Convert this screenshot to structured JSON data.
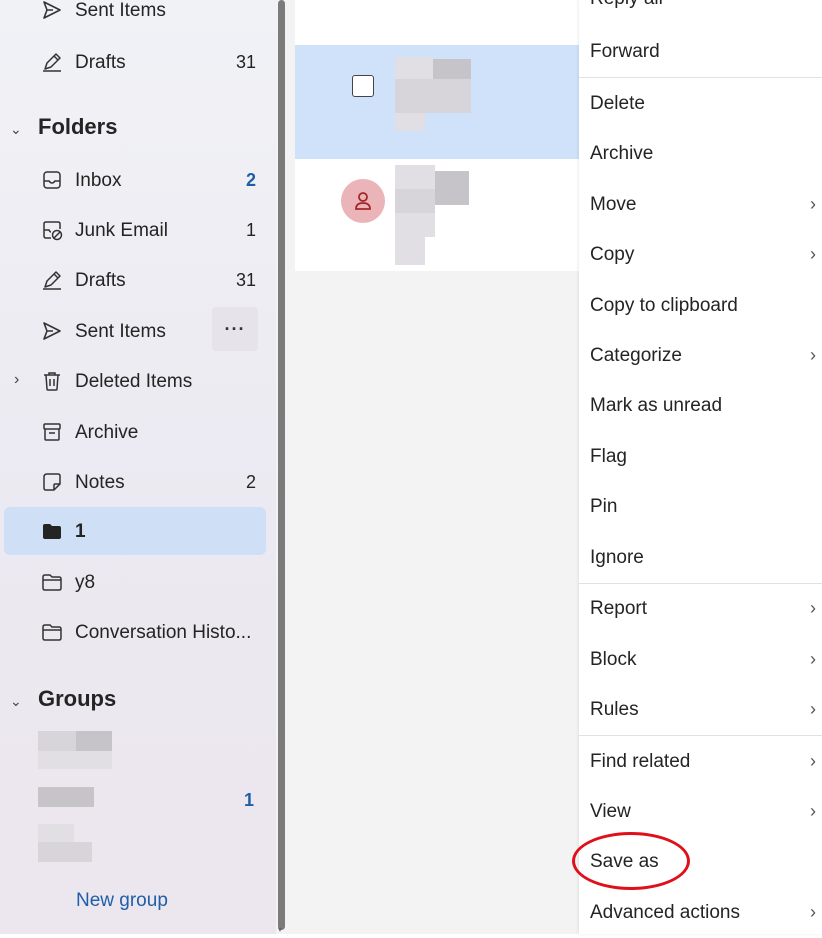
{
  "sidebar": {
    "top_items": [
      {
        "label": "Sent Items",
        "count": ""
      },
      {
        "label": "Drafts",
        "count": "31"
      }
    ],
    "folders_header": "Folders",
    "folders": [
      {
        "label": "Inbox",
        "count": "2",
        "icon": "inbox-icon"
      },
      {
        "label": "Junk Email",
        "count": "1",
        "icon": "junk-email-icon"
      },
      {
        "label": "Drafts",
        "count": "31",
        "icon": "drafts-icon"
      },
      {
        "label": "Sent Items",
        "count": "",
        "icon": "sent-icon"
      },
      {
        "label": "Deleted Items",
        "count": "",
        "icon": "trash-icon"
      },
      {
        "label": "Archive",
        "count": "",
        "icon": "archive-icon"
      },
      {
        "label": "Notes",
        "count": "2",
        "icon": "notes-icon"
      },
      {
        "label": "1",
        "count": "",
        "icon": "folder-filled-icon"
      },
      {
        "label": "y8",
        "count": "",
        "icon": "folder-icon"
      },
      {
        "label": "Conversation Histo...",
        "count": "",
        "icon": "folder-icon"
      }
    ],
    "more_label": "···",
    "groups_header": "Groups",
    "group_count": "1",
    "new_group_label": "New group"
  },
  "context_menu": {
    "partial_top_label": "Reply all",
    "items": [
      {
        "label": "Forward",
        "submenu": false
      },
      {
        "label": "Delete",
        "submenu": false
      },
      {
        "label": "Archive",
        "submenu": false
      },
      {
        "label": "Move",
        "submenu": true
      },
      {
        "label": "Copy",
        "submenu": true
      },
      {
        "label": "Copy to clipboard",
        "submenu": false
      },
      {
        "label": "Categorize",
        "submenu": true
      },
      {
        "label": "Mark as unread",
        "submenu": false
      },
      {
        "label": "Flag",
        "submenu": false
      },
      {
        "label": "Pin",
        "submenu": false
      },
      {
        "label": "Ignore",
        "submenu": false
      },
      {
        "label": "Report",
        "submenu": true
      },
      {
        "label": "Block",
        "submenu": true
      },
      {
        "label": "Rules",
        "submenu": true
      },
      {
        "label": "Find related",
        "submenu": true
      },
      {
        "label": "View",
        "submenu": true
      },
      {
        "label": "Save as",
        "submenu": false
      },
      {
        "label": "Advanced actions",
        "submenu": true
      }
    ],
    "arrow_glyph": "›"
  },
  "colors": {
    "accent": "#1f5ea8",
    "selected_bg": "#cfe0f6",
    "highlight_ring": "#e0101a",
    "avatar_bg": "#eab4b8"
  }
}
